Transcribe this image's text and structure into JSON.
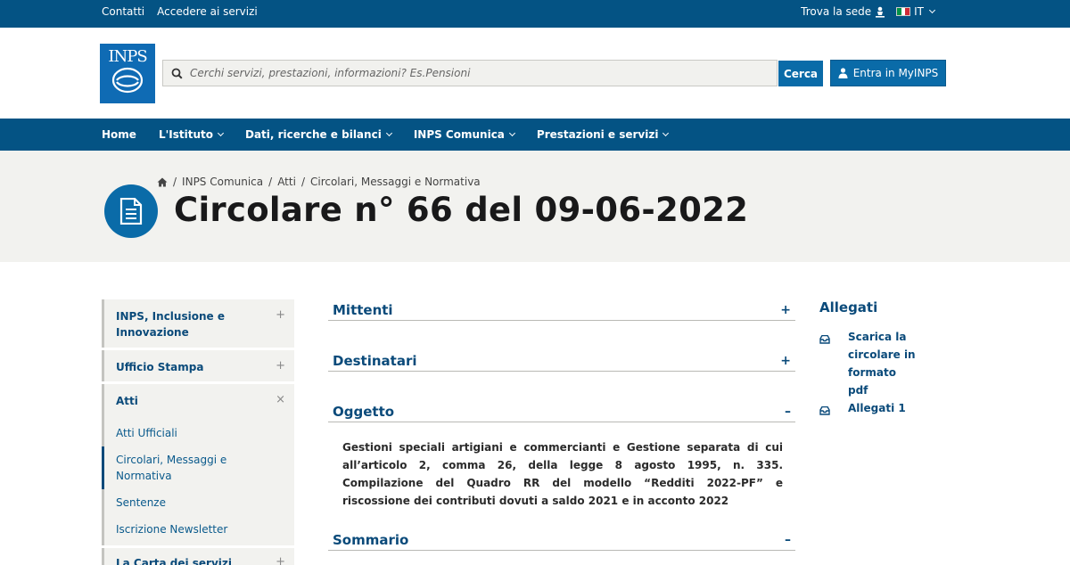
{
  "topbar": {
    "links": [
      "Contatti",
      "Accedere ai servizi"
    ],
    "trova_sede": "Trova la sede",
    "language": "IT",
    "flag_colors": [
      "#009246",
      "#ffffff",
      "#ce2b37"
    ]
  },
  "header": {
    "logo_text": "INPS",
    "search_placeholder": "Cerchi servizi, prestazioni, informazioni? Es.Pensioni",
    "search_button": "Cerca",
    "login_button": "Entra in MyINPS"
  },
  "nav": {
    "items": [
      {
        "label": "Home",
        "dropdown": false
      },
      {
        "label": "L'Istituto",
        "dropdown": true
      },
      {
        "label": "Dati, ricerche e bilanci",
        "dropdown": true
      },
      {
        "label": "INPS Comunica",
        "dropdown": true
      },
      {
        "label": "Prestazioni e servizi",
        "dropdown": true
      }
    ]
  },
  "breadcrumb": [
    "INPS Comunica",
    "Atti",
    "Circolari, Messaggi e Normativa"
  ],
  "page_title": "Circolare n° 66 del 09-06-2022",
  "sidebar": {
    "sections": [
      {
        "label": "INPS, Inclusione e Innovazione",
        "toggle": "+"
      },
      {
        "label": "Ufficio Stampa",
        "toggle": "+"
      },
      {
        "label": "Atti",
        "toggle": "×",
        "children": [
          "Atti Ufficiali",
          "Circolari, Messaggi e Normativa",
          "Sentenze",
          "Iscrizione Newsletter"
        ],
        "active_child": 1
      },
      {
        "label": "La Carta dei servizi dell'INPS",
        "toggle": "+"
      }
    ]
  },
  "accordion": [
    {
      "label": "Mittenti",
      "sign": "+"
    },
    {
      "label": "Destinatari",
      "sign": "+"
    },
    {
      "label": "Oggetto",
      "sign": "–",
      "text": "Gestioni speciali artigiani e commercianti e Gestione separata di cui all’articolo 2, comma 26, della legge 8 agosto 1995, n. 335. Compilazione del Quadro RR del modello “Redditi 2022-PF” e riscossione dei contributi dovuti a saldo 2021 e in acconto 2022"
    },
    {
      "label": "Sommario",
      "sign": "–"
    }
  ],
  "allegati": {
    "title": "Allegati",
    "items": [
      "Scarica la circolare in formato pdf",
      "Allegati 1"
    ]
  }
}
